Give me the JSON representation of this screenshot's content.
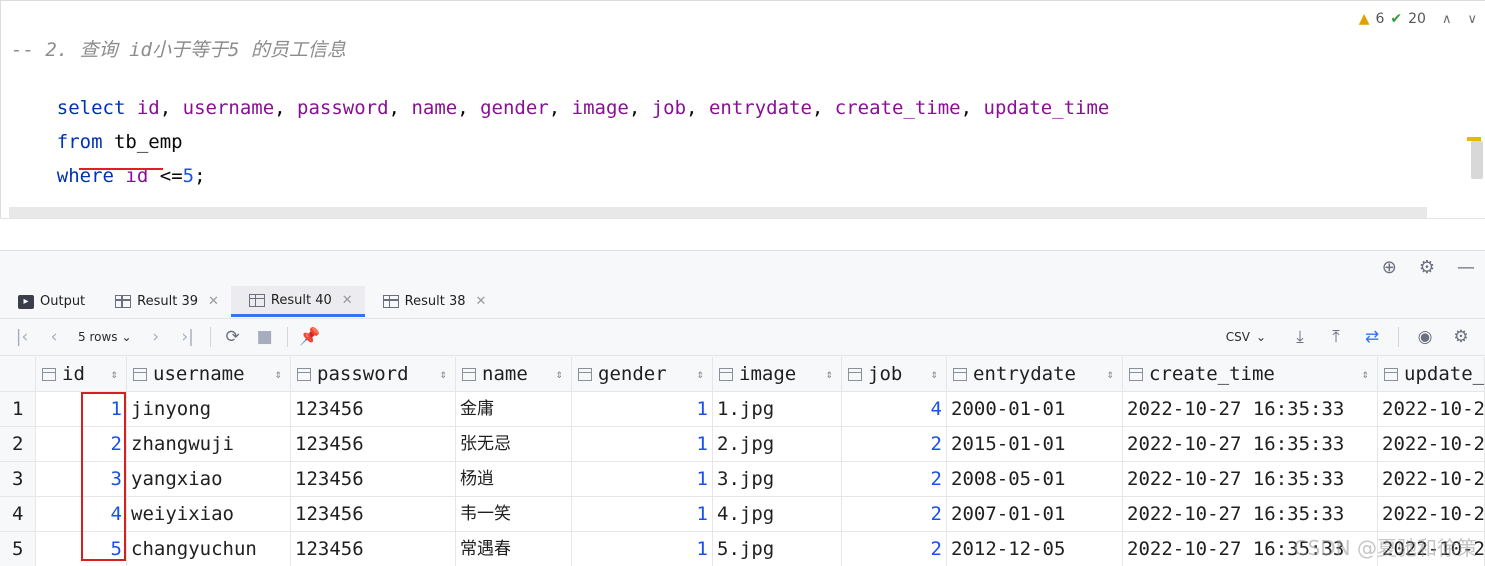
{
  "editor": {
    "comment": "-- 2. 查询 id小于等于5 的员工信息",
    "select_kw": "select",
    "columns_text": [
      " id",
      ", ",
      "username",
      ", ",
      "password",
      ", ",
      "name",
      ", ",
      "gender",
      ", ",
      "image",
      ", ",
      "job",
      ", ",
      "entrydate",
      ", ",
      "create_time",
      ", ",
      "update_time"
    ],
    "from_kw": "from",
    "table": " tb_emp",
    "where_kw": "where",
    "where_col": "id",
    "where_op": " <=",
    "where_val": "5",
    "semicolon": ";",
    "warnings_count": "6",
    "ok_count": "20"
  },
  "tabs": [
    {
      "label": "Output",
      "icon": "output-icon"
    },
    {
      "label": "Result 39",
      "icon": "table-icon"
    },
    {
      "label": "Result 40",
      "icon": "table-icon",
      "active": true
    },
    {
      "label": "Result 38",
      "icon": "table-icon"
    }
  ],
  "toolbar": {
    "rows_label": "5 rows",
    "export_format": "CSV"
  },
  "grid": {
    "headers": [
      "id",
      "username",
      "password",
      "name",
      "gender",
      "image",
      "job",
      "entrydate",
      "create_time",
      "update_time"
    ],
    "rows": [
      {
        "n": "1",
        "id": "1",
        "username": "jinyong",
        "password": "123456",
        "name": "金庸",
        "gender": "1",
        "image": "1.jpg",
        "job": "4",
        "entrydate": "2000-01-01",
        "create_time": "2022-10-27 16:35:33",
        "update_time": "2022-10-2"
      },
      {
        "n": "2",
        "id": "2",
        "username": "zhangwuji",
        "password": "123456",
        "name": "张无忌",
        "gender": "1",
        "image": "2.jpg",
        "job": "2",
        "entrydate": "2015-01-01",
        "create_time": "2022-10-27 16:35:33",
        "update_time": "2022-10-2"
      },
      {
        "n": "3",
        "id": "3",
        "username": "yangxiao",
        "password": "123456",
        "name": "杨逍",
        "gender": "1",
        "image": "3.jpg",
        "job": "2",
        "entrydate": "2008-05-01",
        "create_time": "2022-10-27 16:35:33",
        "update_time": "2022-10-2"
      },
      {
        "n": "4",
        "id": "4",
        "username": "weiyixiao",
        "password": "123456",
        "name": "韦一笑",
        "gender": "1",
        "image": "4.jpg",
        "job": "2",
        "entrydate": "2007-01-01",
        "create_time": "2022-10-27 16:35:33",
        "update_time": "2022-10-2"
      },
      {
        "n": "5",
        "id": "5",
        "username": "changyuchun",
        "password": "123456",
        "name": "常遇春",
        "gender": "1",
        "image": "5.jpg",
        "job": "2",
        "entrydate": "2012-12-05",
        "create_time": "2022-10-27 16:35:33",
        "update_time": "2022-10-2"
      }
    ]
  },
  "watermark": "CSDN @夏驰和徐策",
  "colors": {
    "keyword": "#0033b3",
    "column": "#871094",
    "number": "#1750eb",
    "comment": "#8c8c8c",
    "accent": "#3574f0",
    "highlight": "#d42020"
  }
}
